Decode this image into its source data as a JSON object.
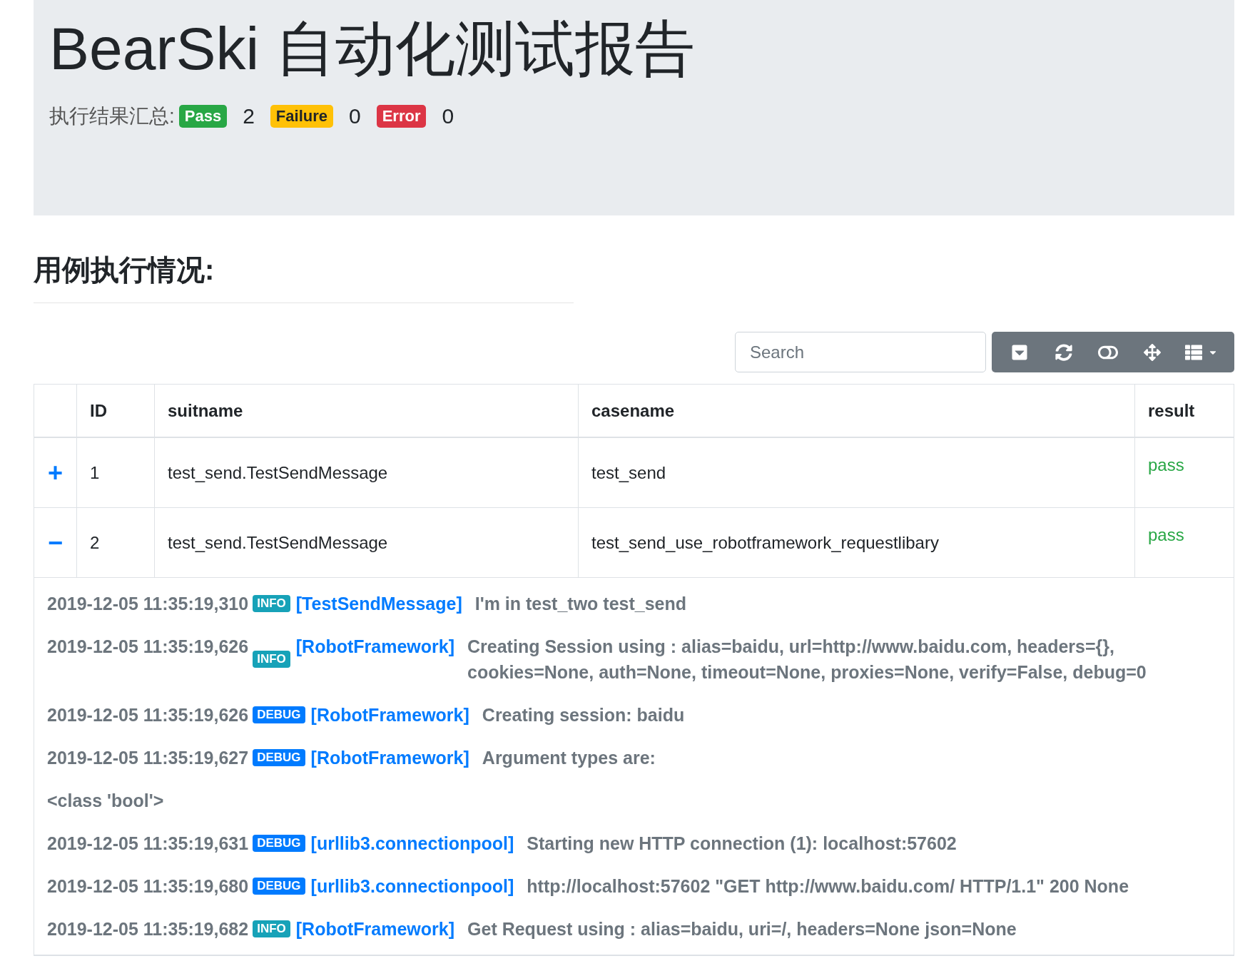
{
  "header": {
    "title": "BearSki 自动化测试报告",
    "summary_label": "执行结果汇总:",
    "results": [
      {
        "kind": "pass",
        "label": "Pass",
        "count": "2"
      },
      {
        "kind": "failure",
        "label": "Failure",
        "count": "0"
      },
      {
        "kind": "error",
        "label": "Error",
        "count": "0"
      }
    ]
  },
  "section_title": "用例执行情况:",
  "toolbar": {
    "search": {
      "placeholder": "Search"
    }
  },
  "table": {
    "columns": [
      "ID",
      "suitname",
      "casename",
      "result"
    ],
    "rows": [
      {
        "toggle": "+",
        "id": "1",
        "suitname": "test_send.TestSendMessage",
        "casename": "test_send",
        "result": "pass",
        "details": []
      },
      {
        "toggle": "−",
        "id": "2",
        "suitname": "test_send.TestSendMessage",
        "casename": "test_send_use_robotframework_requestlibary",
        "result": "pass",
        "details": [
          {
            "kind": "log",
            "time": "2019-12-05 11:35:19,310",
            "level": "INFO",
            "color": "#17a2b8",
            "source": "[TestSendMessage]",
            "message": "I'm in test_two test_send"
          },
          {
            "kind": "log",
            "time": "2019-12-05 11:35:19,626",
            "level": "INFO",
            "color": "#17a2b8",
            "source": "[RobotFramework]",
            "message": "Creating Session using : alias=baidu, url=http://www.baidu.com, headers={}, cookies=None, auth=None, timeout=None, proxies=None, verify=False, debug=0"
          },
          {
            "kind": "log",
            "time": "2019-12-05 11:35:19,626",
            "level": "DEBUG",
            "color": "#007bff",
            "source": "[RobotFramework]",
            "message": "Creating session: baidu"
          },
          {
            "kind": "log",
            "time": "2019-12-05 11:35:19,627",
            "level": "DEBUG",
            "color": "#007bff",
            "source": "[RobotFramework]",
            "message": "Argument types are:"
          },
          {
            "kind": "text",
            "text": "<class 'bool'>"
          },
          {
            "kind": "log",
            "time": "2019-12-05 11:35:19,631",
            "level": "DEBUG",
            "color": "#007bff",
            "source": "[urllib3.connectionpool]",
            "message": "Starting new HTTP connection (1): localhost:57602"
          },
          {
            "kind": "log",
            "time": "2019-12-05 11:35:19,680",
            "level": "DEBUG",
            "color": "#007bff",
            "source": "[urllib3.connectionpool]",
            "message": "http://localhost:57602 \"GET http://www.baidu.com/ HTTP/1.1\" 200 None"
          },
          {
            "kind": "log",
            "time": "2019-12-05 11:35:19,682",
            "level": "INFO",
            "color": "#17a2b8",
            "source": "[RobotFramework]",
            "message": "Get Request using : alias=baidu, uri=/, headers=None json=None"
          }
        ]
      }
    ]
  }
}
